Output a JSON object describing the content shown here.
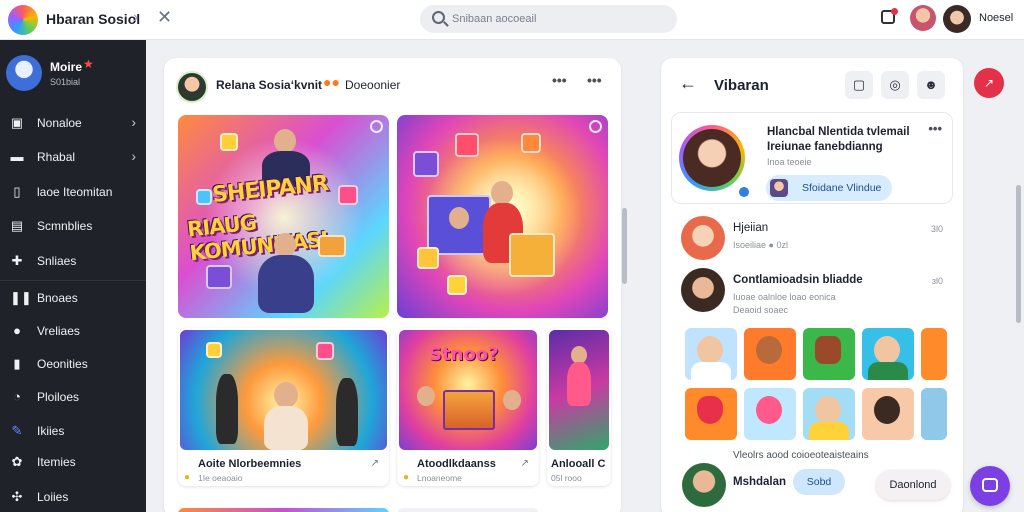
{
  "app": {
    "title": "Hbaran Sosiol",
    "colors": {
      "accent": "#7b3fe4",
      "sidebar_bg": "#1f2229",
      "notification": "#e5304a",
      "chip": "#d7ecff"
    }
  },
  "topbar": {
    "search_placeholder": "Snibaan aocoeail",
    "user_label": "Noesel",
    "icons": [
      "chevron-right-icon",
      "close-icon",
      "search-icon",
      "notification-icon"
    ]
  },
  "sidebar": {
    "profile": {
      "name": "Moire",
      "sub": "S01bial"
    },
    "items": [
      {
        "label": "Nonaloe",
        "icon": "image-icon",
        "has_arrow": true
      },
      {
        "label": "Rhabal",
        "icon": "folder-icon",
        "has_arrow": true
      },
      {
        "label": "laoe Iteomitan",
        "icon": "page-icon",
        "has_arrow": false
      },
      {
        "label": "Scmnblies",
        "icon": "grid-icon",
        "has_arrow": false
      },
      {
        "label": "Snliaes",
        "icon": "puzzle-icon",
        "has_arrow": false
      },
      {
        "label": "Bnoaes",
        "icon": "columns-icon",
        "has_arrow": false
      },
      {
        "label": "Vreliaes",
        "icon": "chat-icon",
        "has_arrow": false
      },
      {
        "label": "Oeonities",
        "icon": "bookmark-icon",
        "has_arrow": false
      },
      {
        "label": "Ploiloes",
        "icon": "clock-icon",
        "has_arrow": false
      },
      {
        "label": "Ikiies",
        "icon": "pen-icon",
        "has_arrow": false
      },
      {
        "label": "Itemies",
        "icon": "gift-icon",
        "has_arrow": false
      },
      {
        "label": "Loiies",
        "icon": "apps-icon",
        "has_arrow": false
      }
    ]
  },
  "feed": {
    "title": "Relana Sosiaʻkvnit",
    "emoji": "●●",
    "subtitle": "Doeoonier",
    "banner_line1": "SHEIPANR",
    "banner_line2": "RIAUG KOMUNITASI",
    "cards": [
      {
        "title": "Aoite Nlorbeemnies",
        "meta": "1Ie oeaoaio"
      },
      {
        "title": "Atoodlkdaanss",
        "meta": "Lnoaneome",
        "art_text": "Stnoo?"
      },
      {
        "title": "Anlooall C",
        "meta": "05l rooo"
      }
    ]
  },
  "detail": {
    "title": "Vibaran",
    "profile_card": {
      "name": "Hlancbal Nlentida tvlemail Ireiunae fanebdianng",
      "sub": "Inoa teoeie",
      "chip": "Sfoidane Vlindue"
    },
    "comments": [
      {
        "name": "Hjeiian",
        "text": "Isoeiliae ● 0zl",
        "time": "3l0"
      },
      {
        "name": "Contlamioadsin bliadde",
        "text": "Iuoae oalnloe loao eonica",
        "text2": "Deaoid soaec",
        "time": "ɜl0"
      }
    ],
    "gallery_caption": "Vleolrs aood coioeoteaisteains",
    "footer": {
      "name": "Mshdalan",
      "chip": "Sobd"
    },
    "download_label": "Daonlond"
  }
}
